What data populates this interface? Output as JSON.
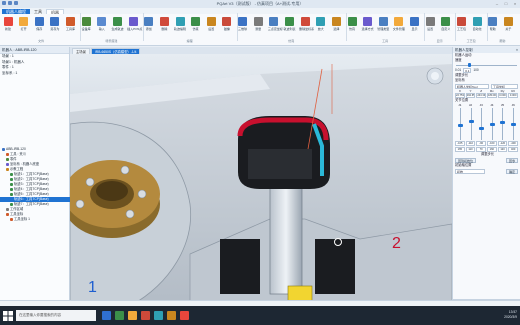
{
  "window": {
    "title": "PQArt V3（测试版） - 仿真项目（A+测试-专用）"
  },
  "menu": {
    "tabs": [
      "机器人编程",
      "工具",
      "机器"
    ],
    "active_index": 0,
    "current_index": 2
  },
  "ribbon": {
    "tools": [
      {
        "label": "新建",
        "color": "#e8463c"
      },
      {
        "label": "打开",
        "color": "#f2a93b"
      },
      {
        "label": "保存",
        "color": "#3a72c4"
      },
      {
        "label": "另存为",
        "color": "#3a72c4"
      },
      {
        "label": "工具库",
        "color": "#d05a2a"
      },
      {
        "label": "设备库",
        "color": "#4a8a3c"
      },
      {
        "label": "输入",
        "color": "#5a8ad0"
      },
      {
        "label": "生成轨迹",
        "color": "#3b8f49"
      },
      {
        "label": "插入POS点",
        "color": "#6a5acd"
      },
      {
        "label": "添加",
        "color": "#4a7fc1"
      },
      {
        "label": "删除",
        "color": "#d04a3a"
      },
      {
        "label": "轨迹编辑",
        "color": "#2f9fb3"
      },
      {
        "label": "仿真",
        "color": "#3b8f49"
      },
      {
        "label": "后置",
        "color": "#c9861f"
      },
      {
        "label": "碰撞",
        "color": "#c94a3a"
      },
      {
        "label": "三维球",
        "color": "#3a72c4"
      },
      {
        "label": "测量",
        "color": "#7a7a7a"
      },
      {
        "label": "三点定坐标",
        "color": "#4a7fc1"
      },
      {
        "label": "轨迹列表",
        "color": "#3b8f49"
      },
      {
        "label": "删除坐标系",
        "color": "#d04a3a"
      },
      {
        "label": "放大",
        "color": "#2f9fb3"
      },
      {
        "label": "选择",
        "color": "#c9861f"
      },
      {
        "label": "仿真",
        "color": "#3b8f49"
      },
      {
        "label": "选择方式",
        "color": "#6a5acd"
      },
      {
        "label": "管理类型",
        "color": "#4a7fc1"
      },
      {
        "label": "文件管理",
        "color": "#f2a93b"
      },
      {
        "label": "显示",
        "color": "#3a72c4"
      },
      {
        "label": "设置",
        "color": "#7a7a7a"
      },
      {
        "label": "自定义",
        "color": "#3b8f49"
      },
      {
        "label": "工艺包",
        "color": "#c94a3a"
      },
      {
        "label": "自动化",
        "color": "#2f9fb3"
      },
      {
        "label": "帮助",
        "color": "#4a7fc1"
      },
      {
        "label": "关于",
        "color": "#c9861f"
      }
    ],
    "groups": [
      "文件",
      "场景搭建",
      "编程",
      "仿真",
      "工具",
      "显示",
      "工艺包",
      "帮助"
    ]
  },
  "left_panel": {
    "header": "机器人 : ABB-IRB-120",
    "rows": [
      "场景 : 1",
      "场景1 : 机器人",
      "零件 : 1",
      "坐标系 : 1"
    ],
    "tree": [
      {
        "label": "ABB-IRB-120",
        "color": "#3a72c4",
        "indent": 0
      },
      {
        "label": "工具 : 夹爪",
        "color": "#d05a2a",
        "indent": 1
      },
      {
        "label": "零件",
        "color": "#4a8a3c",
        "indent": 1
      },
      {
        "label": "坐标系 : 机器人底座",
        "color": "#6a5acd",
        "indent": 1
      },
      {
        "label": "示教工程",
        "color": "#c9861f",
        "indent": 1
      },
      {
        "label": "轨迹1：工具TCP(Base)",
        "color": "#3b8f49",
        "indent": 2
      },
      {
        "label": "轨迹2：工具TCP(Base)",
        "color": "#3b8f49",
        "indent": 2
      },
      {
        "label": "轨迹3：工具TCP(Base)",
        "color": "#3b8f49",
        "indent": 2
      },
      {
        "label": "轨迹4：工具TCP(Base)",
        "color": "#3b8f49",
        "indent": 2
      },
      {
        "label": "轨迹5：工具TCP(Base)",
        "color": "#3b8f49",
        "indent": 2
      },
      {
        "label": "轨迹6：工具TCP(Base)",
        "color": "#1f73d2",
        "indent": 2,
        "selected": true
      },
      {
        "label": "轨迹7：工具TCP(Base)",
        "color": "#3b8f49",
        "indent": 2
      },
      {
        "label": "工作区域",
        "color": "#7a7a7a",
        "indent": 1
      },
      {
        "label": "工具坐标",
        "color": "#d05a2a",
        "indent": 1
      },
      {
        "label": "工具坐标 1",
        "color": "#d05a2a",
        "indent": 2
      }
    ]
  },
  "viewport": {
    "tabs": [
      "主场景",
      "IRB-6650S（仿真模型）-1/4"
    ],
    "active_tab": 1,
    "axis_labels": [
      "1",
      "2"
    ],
    "bg_gradient_top": "#e6ecf2",
    "bg_gradient_bottom": "#a9b4bf"
  },
  "right_panel": {
    "header": "机器人控制",
    "close_label": "×",
    "section1": "机器人运动",
    "speed_label": "速度",
    "speed_min": "0.01",
    "speed_value": "0.1",
    "speed_max": "100",
    "step_label": "调整步长",
    "coord_label": "坐标系",
    "coord_value": "机器人坐标Tool",
    "ref_value": "工具坐标",
    "joint_headers": [
      "X",
      "Y",
      "Z",
      "Rx",
      "Ry",
      "Rz"
    ],
    "joint_values": [
      "22.753",
      "294.651",
      "243.393",
      "180.000",
      "0.000",
      "0.000"
    ],
    "axis_label": "关节位置",
    "axis_headers": [
      "J1",
      "J2",
      "J3",
      "J4",
      "J5",
      "J6"
    ],
    "axis_slider_levels": [
      0.45,
      0.6,
      0.35,
      0.5,
      0.55,
      0.5
    ],
    "axis_values_a": [
      "-165",
      "-110",
      "-90",
      "-160",
      "-120",
      "-400"
    ],
    "axis_values_b": [
      "165",
      "110",
      "70",
      "160",
      "120",
      "400"
    ],
    "step2_label": "调整步长",
    "btn_reset": "回到初始位",
    "btn_home": "回零",
    "home_label": "初始轴位置",
    "home_value": "初始",
    "btn_apply": "确定",
    "tabs": [
      "机器人属性",
      "机器人控制",
      "轨迹"
    ],
    "active_tab": 1
  },
  "taskbar": {
    "search_placeholder": "在这里输入你要搜索的内容",
    "time": "13:57",
    "date": "2020/3/9",
    "icons": [
      "#2f6fd0",
      "#3b8f49",
      "#f2a93b",
      "#d04a3a",
      "#2f9fb3",
      "#c9861f",
      "#e8463c"
    ]
  }
}
